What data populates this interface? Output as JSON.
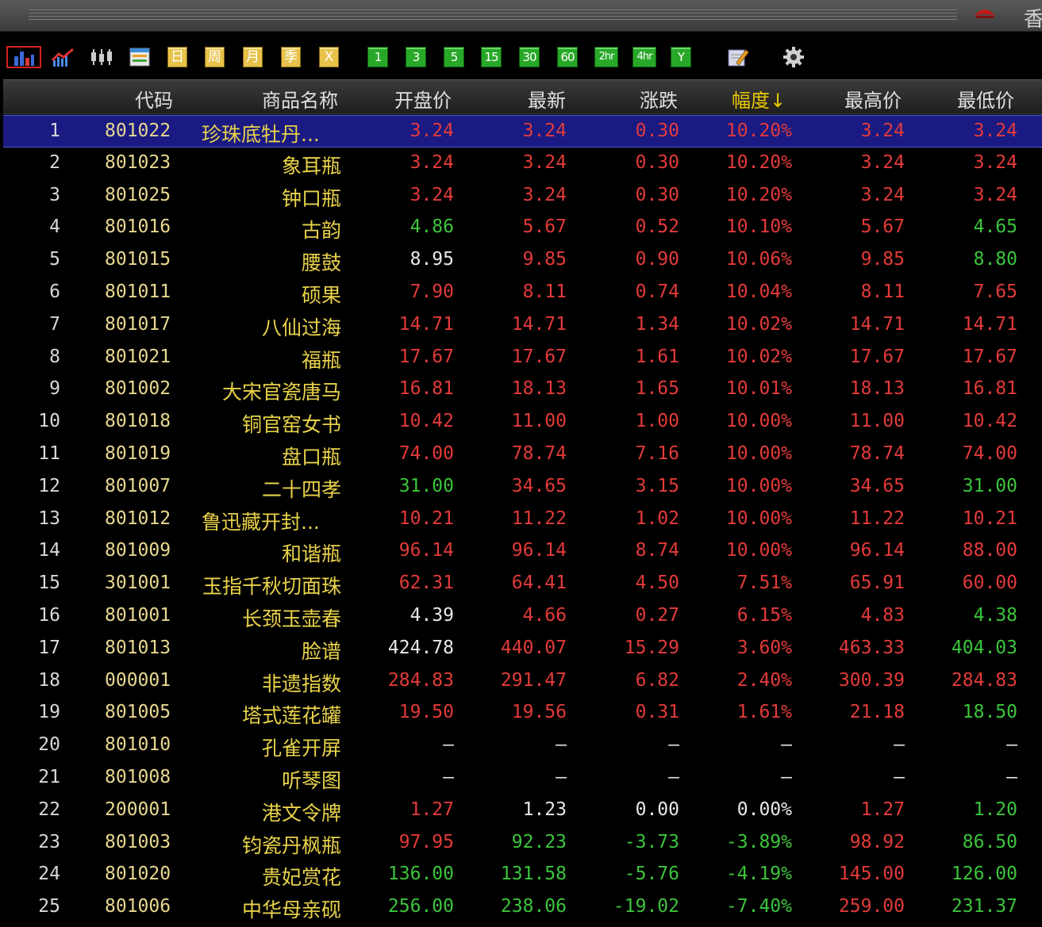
{
  "titlebar": {
    "partial_title": "香"
  },
  "toolbar": {
    "periods": {
      "day": "日",
      "week": "周",
      "month": "月",
      "season": "季",
      "x": "X"
    },
    "minutes": {
      "m1": "1",
      "m3": "3",
      "m5": "5",
      "m15": "15",
      "m30": "30",
      "m60": "60",
      "h2": "2hr",
      "h4": "4hr",
      "y": "Y"
    }
  },
  "columns": {
    "code": "代码",
    "name": "商品名称",
    "open": "开盘价",
    "last": "最新",
    "change": "涨跌",
    "pct": "幅度↓",
    "high": "最高价",
    "low": "最低价"
  },
  "colors": {
    "up": "#e33a3a",
    "down": "#3cc43c",
    "flat": "#e8e8e8",
    "name": "#e8d24a",
    "selected_row": "#1a1a82",
    "sorted_header": "#e8c800"
  },
  "rows": [
    {
      "idx": "1",
      "code": "801022",
      "name": "珍珠底牡丹...",
      "open": "3.24",
      "last": "3.24",
      "change": "0.30",
      "pct": "10.20%",
      "high": "3.24",
      "low": "3.24",
      "cls": [
        "r",
        "r",
        "r",
        "r",
        "r",
        "r"
      ]
    },
    {
      "idx": "2",
      "code": "801023",
      "name": "象耳瓶",
      "open": "3.24",
      "last": "3.24",
      "change": "0.30",
      "pct": "10.20%",
      "high": "3.24",
      "low": "3.24",
      "cls": [
        "r",
        "r",
        "r",
        "r",
        "r",
        "r"
      ]
    },
    {
      "idx": "3",
      "code": "801025",
      "name": "钟口瓶",
      "open": "3.24",
      "last": "3.24",
      "change": "0.30",
      "pct": "10.20%",
      "high": "3.24",
      "low": "3.24",
      "cls": [
        "r",
        "r",
        "r",
        "r",
        "r",
        "r"
      ]
    },
    {
      "idx": "4",
      "code": "801016",
      "name": "古韵",
      "open": "4.86",
      "last": "5.67",
      "change": "0.52",
      "pct": "10.10%",
      "high": "5.67",
      "low": "4.65",
      "cls": [
        "g",
        "r",
        "r",
        "r",
        "r",
        "g"
      ]
    },
    {
      "idx": "5",
      "code": "801015",
      "name": "腰鼓",
      "open": "8.95",
      "last": "9.85",
      "change": "0.90",
      "pct": "10.06%",
      "high": "9.85",
      "low": "8.80",
      "cls": [
        "w",
        "r",
        "r",
        "r",
        "r",
        "g"
      ]
    },
    {
      "idx": "6",
      "code": "801011",
      "name": "硕果",
      "open": "7.90",
      "last": "8.11",
      "change": "0.74",
      "pct": "10.04%",
      "high": "8.11",
      "low": "7.65",
      "cls": [
        "r",
        "r",
        "r",
        "r",
        "r",
        "r"
      ]
    },
    {
      "idx": "7",
      "code": "801017",
      "name": "八仙过海",
      "open": "14.71",
      "last": "14.71",
      "change": "1.34",
      "pct": "10.02%",
      "high": "14.71",
      "low": "14.71",
      "cls": [
        "r",
        "r",
        "r",
        "r",
        "r",
        "r"
      ]
    },
    {
      "idx": "8",
      "code": "801021",
      "name": "福瓶",
      "open": "17.67",
      "last": "17.67",
      "change": "1.61",
      "pct": "10.02%",
      "high": "17.67",
      "low": "17.67",
      "cls": [
        "r",
        "r",
        "r",
        "r",
        "r",
        "r"
      ]
    },
    {
      "idx": "9",
      "code": "801002",
      "name": "大宋官瓷唐马",
      "open": "16.81",
      "last": "18.13",
      "change": "1.65",
      "pct": "10.01%",
      "high": "18.13",
      "low": "16.81",
      "cls": [
        "r",
        "r",
        "r",
        "r",
        "r",
        "r"
      ]
    },
    {
      "idx": "10",
      "code": "801018",
      "name": "铜官窑女书",
      "open": "10.42",
      "last": "11.00",
      "change": "1.00",
      "pct": "10.00%",
      "high": "11.00",
      "low": "10.42",
      "cls": [
        "r",
        "r",
        "r",
        "r",
        "r",
        "r"
      ]
    },
    {
      "idx": "11",
      "code": "801019",
      "name": "盘口瓶",
      "open": "74.00",
      "last": "78.74",
      "change": "7.16",
      "pct": "10.00%",
      "high": "78.74",
      "low": "74.00",
      "cls": [
        "r",
        "r",
        "r",
        "r",
        "r",
        "r"
      ]
    },
    {
      "idx": "12",
      "code": "801007",
      "name": "二十四孝",
      "open": "31.00",
      "last": "34.65",
      "change": "3.15",
      "pct": "10.00%",
      "high": "34.65",
      "low": "31.00",
      "cls": [
        "g",
        "r",
        "r",
        "r",
        "r",
        "g"
      ]
    },
    {
      "idx": "13",
      "code": "801012",
      "name": "鲁迅藏开封...",
      "open": "10.21",
      "last": "11.22",
      "change": "1.02",
      "pct": "10.00%",
      "high": "11.22",
      "low": "10.21",
      "cls": [
        "r",
        "r",
        "r",
        "r",
        "r",
        "r"
      ]
    },
    {
      "idx": "14",
      "code": "801009",
      "name": "和谐瓶",
      "open": "96.14",
      "last": "96.14",
      "change": "8.74",
      "pct": "10.00%",
      "high": "96.14",
      "low": "88.00",
      "cls": [
        "r",
        "r",
        "r",
        "r",
        "r",
        "r"
      ]
    },
    {
      "idx": "15",
      "code": "301001",
      "name": "玉指千秋切面珠",
      "open": "62.31",
      "last": "64.41",
      "change": "4.50",
      "pct": "7.51%",
      "high": "65.91",
      "low": "60.00",
      "cls": [
        "r",
        "r",
        "r",
        "r",
        "r",
        "r"
      ]
    },
    {
      "idx": "16",
      "code": "801001",
      "name": "长颈玉壶春",
      "open": "4.39",
      "last": "4.66",
      "change": "0.27",
      "pct": "6.15%",
      "high": "4.83",
      "low": "4.38",
      "cls": [
        "w",
        "r",
        "r",
        "r",
        "r",
        "g"
      ]
    },
    {
      "idx": "17",
      "code": "801013",
      "name": "脸谱",
      "open": "424.78",
      "last": "440.07",
      "change": "15.29",
      "pct": "3.60%",
      "high": "463.33",
      "low": "404.03",
      "cls": [
        "w",
        "r",
        "r",
        "r",
        "r",
        "g"
      ]
    },
    {
      "idx": "18",
      "code": "000001",
      "name": "非遗指数",
      "open": "284.83",
      "last": "291.47",
      "change": "6.82",
      "pct": "2.40%",
      "high": "300.39",
      "low": "284.83",
      "cls": [
        "r",
        "r",
        "r",
        "r",
        "r",
        "r"
      ]
    },
    {
      "idx": "19",
      "code": "801005",
      "name": "塔式莲花罐",
      "open": "19.50",
      "last": "19.56",
      "change": "0.31",
      "pct": "1.61%",
      "high": "21.18",
      "low": "18.50",
      "cls": [
        "r",
        "r",
        "r",
        "r",
        "r",
        "g"
      ]
    },
    {
      "idx": "20",
      "code": "801010",
      "name": "孔雀开屏",
      "open": "—",
      "last": "—",
      "change": "—",
      "pct": "—",
      "high": "—",
      "low": "—",
      "cls": [
        "w",
        "w",
        "w",
        "w",
        "w",
        "w"
      ]
    },
    {
      "idx": "21",
      "code": "801008",
      "name": "听琴图",
      "open": "—",
      "last": "—",
      "change": "—",
      "pct": "—",
      "high": "—",
      "low": "—",
      "cls": [
        "w",
        "w",
        "w",
        "w",
        "w",
        "w"
      ]
    },
    {
      "idx": "22",
      "code": "200001",
      "name": "港文令牌",
      "open": "1.27",
      "last": "1.23",
      "change": "0.00",
      "pct": "0.00%",
      "high": "1.27",
      "low": "1.20",
      "cls": [
        "r",
        "w",
        "w",
        "w",
        "r",
        "g"
      ]
    },
    {
      "idx": "23",
      "code": "801003",
      "name": "钧瓷丹枫瓶",
      "open": "97.95",
      "last": "92.23",
      "change": "-3.73",
      "pct": "-3.89%",
      "high": "98.92",
      "low": "86.50",
      "cls": [
        "r",
        "g",
        "g",
        "g",
        "r",
        "g"
      ]
    },
    {
      "idx": "24",
      "code": "801020",
      "name": "贵妃赏花",
      "open": "136.00",
      "last": "131.58",
      "change": "-5.76",
      "pct": "-4.19%",
      "high": "145.00",
      "low": "126.00",
      "cls": [
        "g",
        "g",
        "g",
        "g",
        "r",
        "g"
      ]
    },
    {
      "idx": "25",
      "code": "801006",
      "name": "中华母亲砚",
      "open": "256.00",
      "last": "238.06",
      "change": "-19.02",
      "pct": "-7.40%",
      "high": "259.00",
      "low": "231.37",
      "cls": [
        "g",
        "g",
        "g",
        "g",
        "r",
        "g"
      ]
    }
  ]
}
